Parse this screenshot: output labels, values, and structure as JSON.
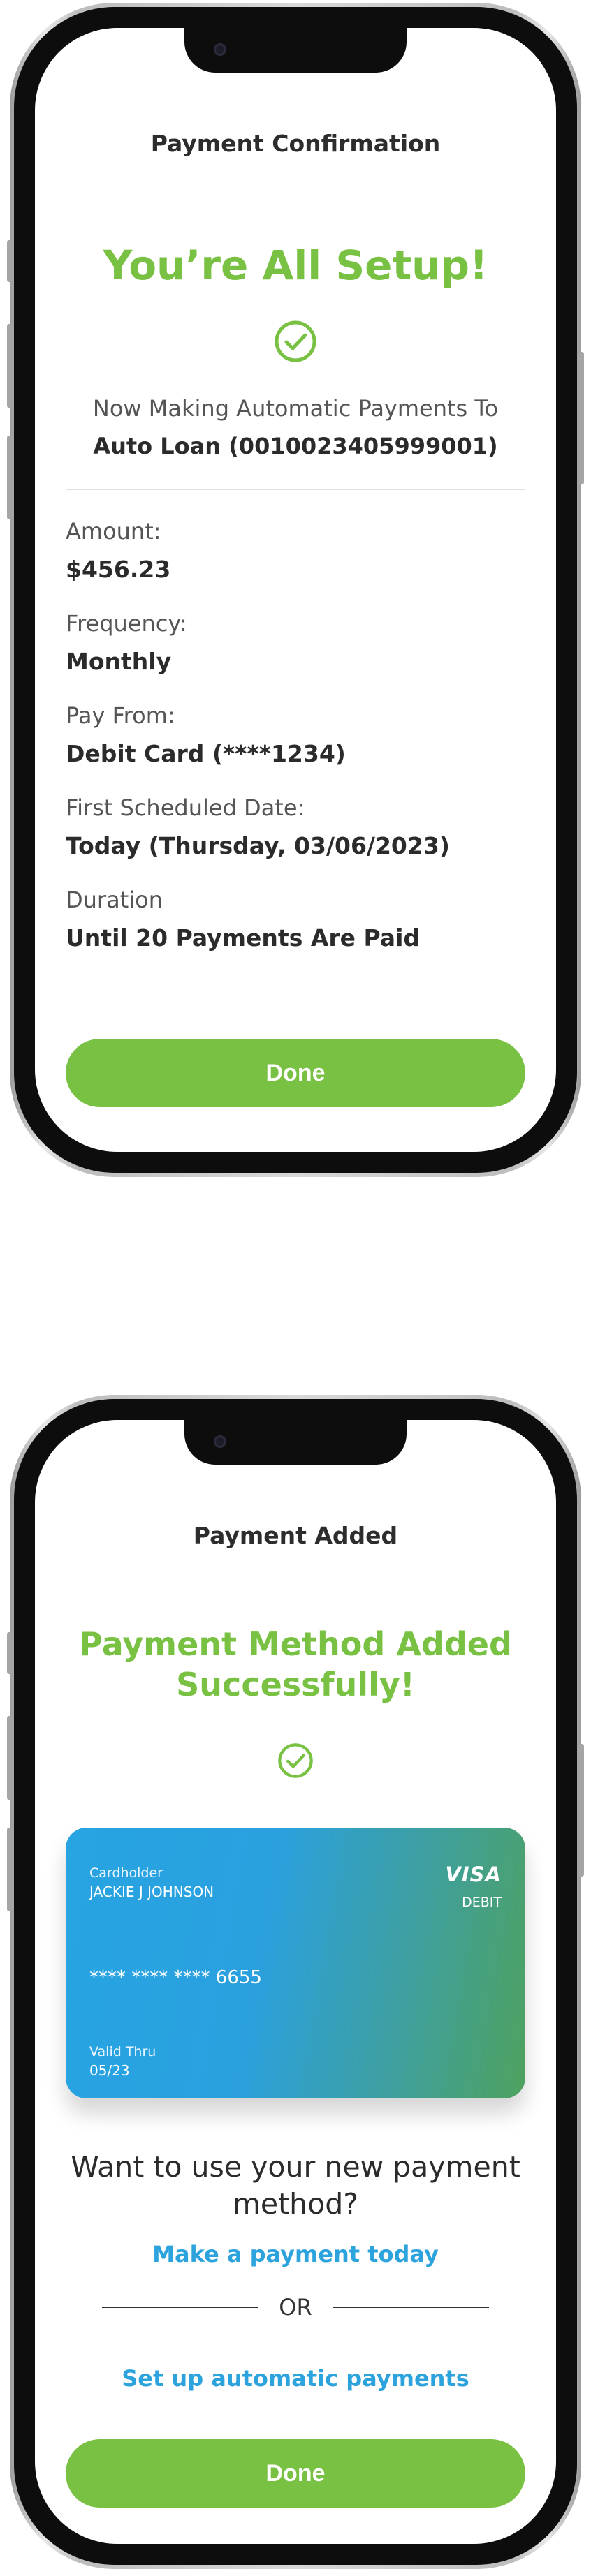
{
  "confirmation_screen": {
    "title": "Payment Confirmation",
    "headline": "You’re All Setup!",
    "subtitle": "Now Making Automatic Payments To",
    "account": "Auto Loan (0010023405999001)",
    "fields": [
      {
        "label": "Amount:",
        "value": "$456.23"
      },
      {
        "label": "Frequency:",
        "value": "Monthly"
      },
      {
        "label": "Pay From:",
        "value": "Debit Card (****1234)"
      },
      {
        "label": "First Scheduled Date:",
        "value": "Today (Thursday, 03/06/2023)"
      },
      {
        "label": "Duration",
        "value": "Until 20 Payments Are Paid"
      }
    ],
    "done_label": "Done"
  },
  "payment_added_screen": {
    "title": "Payment Added",
    "headline_line1": "Payment Method Added",
    "headline_line2": "Successfully!",
    "card": {
      "cardholder_label": "Cardholder",
      "cardholder_name": "JACKIE J JOHNSON",
      "number": "**** **** **** 6655",
      "valid_label": "Valid Thru",
      "valid_value": "05/23",
      "brand": "VISA",
      "type": "DEBIT"
    },
    "question_line1": "Want to use your new payment",
    "question_line2": "method?",
    "link_make_payment": "Make a payment today",
    "or_text": "OR",
    "link_auto_payments": "Set up automatic payments",
    "done_label": "Done"
  },
  "colors": {
    "accent_green": "#78c142",
    "link_blue": "#2da3dd"
  },
  "icons": [
    "check-circle-icon",
    "camera-icon"
  ]
}
